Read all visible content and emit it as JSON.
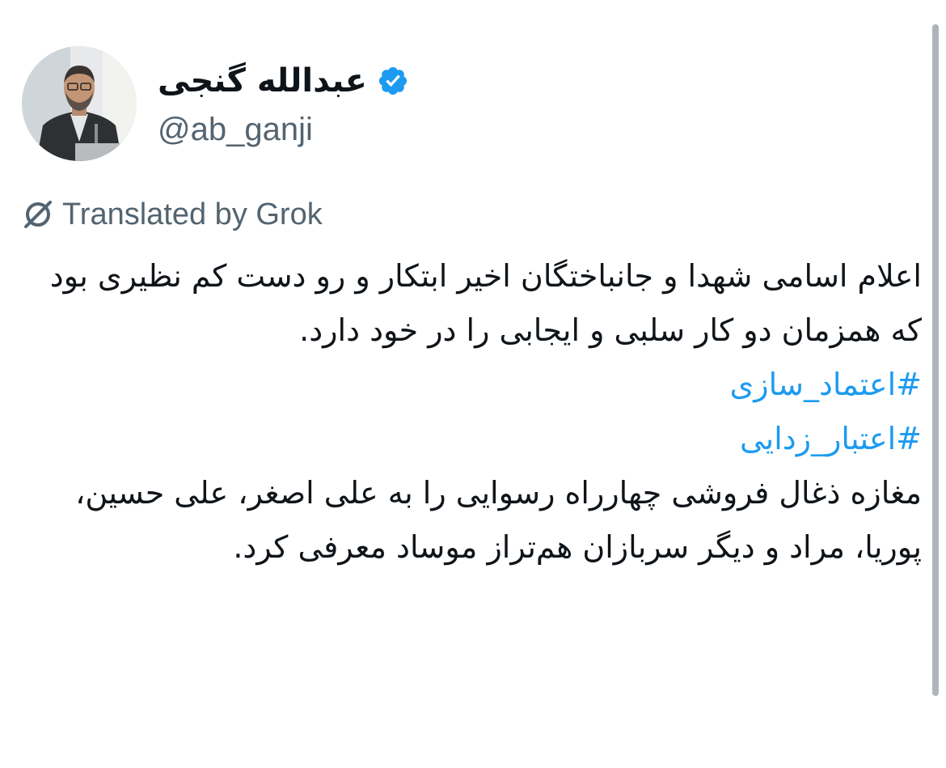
{
  "author": {
    "display_name": "عبدالله گنجی",
    "handle": "@ab_ganji",
    "avatar_icon": "avatar-photo",
    "verified_icon": "verified-badge-icon",
    "verified_color": "#1d9bf0"
  },
  "translation_notice": {
    "icon": "grok-icon",
    "text": "Translated by Grok"
  },
  "tweet": {
    "paragraph_1": "اعلام اسامی شهدا و جانباختگان اخیر ابتکار و رو دست کم نظیری بود که همزمان دو کار سلبی و ایجابی را در خود دارد.",
    "hashtags": [
      "#اعتماد_سازی",
      "#اعتبار_زدایی"
    ],
    "paragraph_2": "مغازه ذغال فروشی چهارراه رسوایی را به علی اصغر، علی حسین، پوریا، مراد و دیگر سربازان هم‌تراز موساد معرفی کرد."
  },
  "colors": {
    "text": "#0f1419",
    "secondary": "#536471",
    "link": "#1d9bf0"
  }
}
